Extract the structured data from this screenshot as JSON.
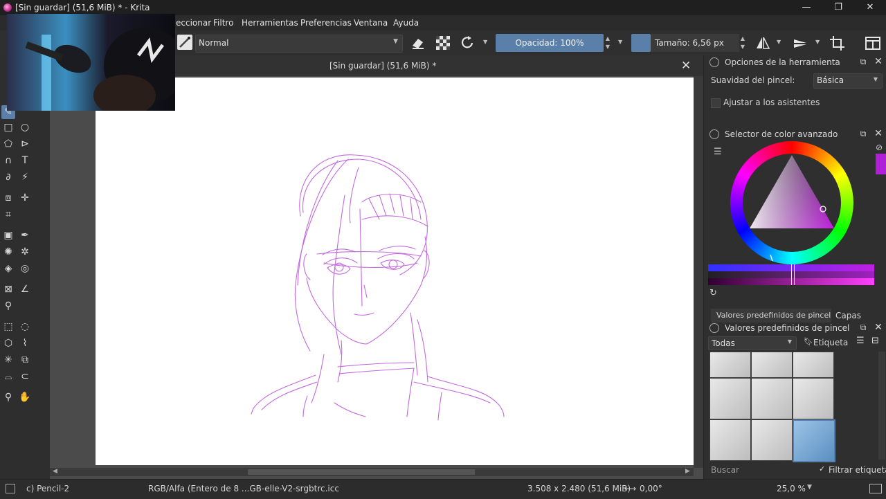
{
  "window": {
    "title": "[Sin guardar]  (51,6 MiB) * - Krita",
    "minimize": "—",
    "maximize": "❐",
    "close": "✕"
  },
  "menu": {
    "items": [
      "eccionar",
      "Filtro",
      "Herramientas",
      "Preferencias",
      "Ventana",
      "Ayuda"
    ]
  },
  "toolbar": {
    "blend_mode": "Normal",
    "opacity": "Opacidad: 100%",
    "size": "Tamaño: 6,56 px"
  },
  "document": {
    "tab_title": "[Sin guardar]  (51,6 MiB) *"
  },
  "tool_options": {
    "header": "Opciones de la herramienta",
    "smoothing_label": "Suavidad del pincel:",
    "smoothing_value": "Básica",
    "assistants_label": "Ajustar a los asistentes"
  },
  "color_selector": {
    "header": "Selector de color avanzado",
    "current_color": "#b020d8"
  },
  "brush_presets": {
    "tab_presets": "Valores predefinidos de pincel",
    "tab_layers": "Capas",
    "header": "Valores predefinidos de pincel",
    "filter_all": "Todas",
    "tag_label": "Etiqueta",
    "search_placeholder": "Buscar",
    "filter_tag": "Filtrar etiqueta"
  },
  "status": {
    "preset_name": "c) Pencil-2",
    "color_space": "RGB/Alfa (Entero de 8 ...GB-elle-V2-srgbtrc.icc",
    "image_size": "3.508 x 2.480 (51,6 MiB)",
    "rotation": "0,00°",
    "zoom": "25,0 %"
  },
  "colors": {
    "accent": "#5a7fa8",
    "sketch": "#b84fd8"
  }
}
